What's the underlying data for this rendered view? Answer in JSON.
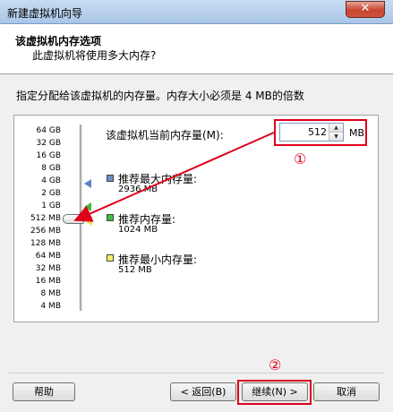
{
  "window": {
    "title": "新建虚拟机向导",
    "close_label": "✕"
  },
  "header": {
    "heading": "该虚拟机内存选项",
    "subheading": "此虚拟机将使用多大内存?"
  },
  "description": "指定分配给该虚拟机的内存量。内存大小必须是 4 MB的倍数",
  "memory": {
    "scale_labels": [
      "64 GB",
      "32 GB",
      "16 GB",
      "8 GB",
      "4 GB",
      "2 GB",
      "1 GB",
      "512 MB",
      "256 MB",
      "128 MB",
      "64 MB",
      "32 MB",
      "16 MB",
      "8 MB",
      "4 MB"
    ],
    "current_label": "该虚拟机当前内存量(M):",
    "value": "512",
    "unit": "MB",
    "recommended_max": {
      "title": "推荐最大内存量:",
      "value": "2936 MB",
      "color": "#6b8fc7"
    },
    "recommended": {
      "title": "推荐内存量:",
      "value": "1024 MB",
      "color": "#3cbf3c"
    },
    "recommended_min": {
      "title": "推荐最小内存量:",
      "value": "512 MB",
      "color": "#f3ef6c"
    }
  },
  "annotations": {
    "one": "①",
    "two": "②"
  },
  "buttons": {
    "help": "帮助",
    "back": "< 返回(B)",
    "next": "继续(N) >",
    "cancel": "取消"
  },
  "colors": {
    "annotation_red": "#e0001a"
  }
}
